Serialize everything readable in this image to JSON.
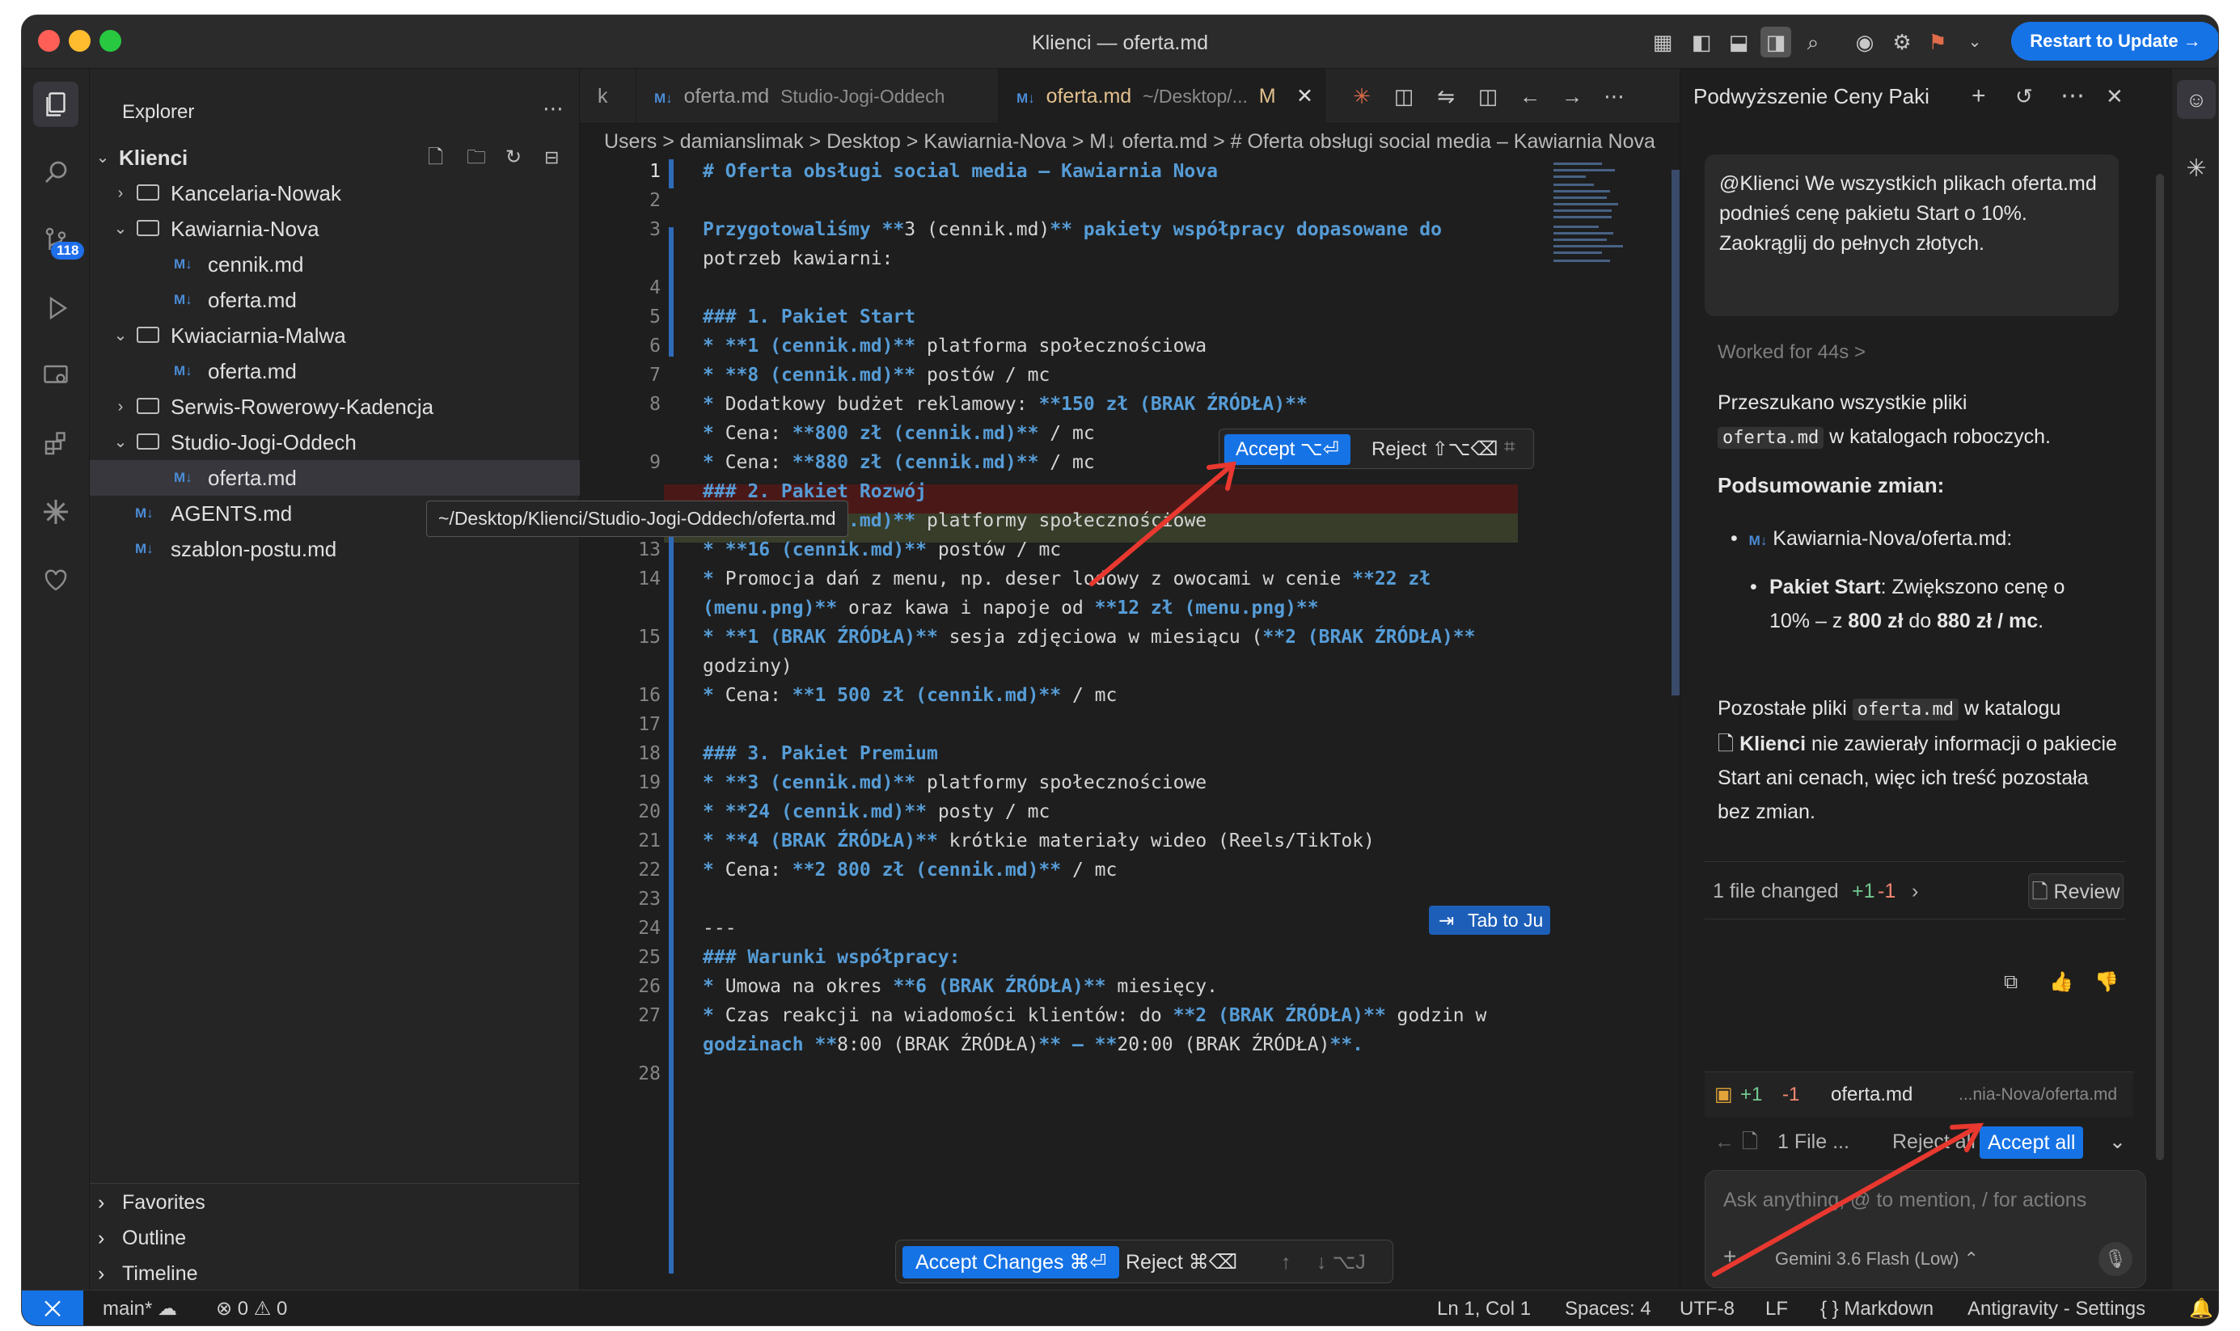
{
  "window": {
    "title": "Klienci — oferta.md",
    "restart_label": "Restart to Update →"
  },
  "activity": {
    "scm_badge": "118"
  },
  "explorer": {
    "title": "Explorer",
    "root": "Klienci",
    "rows": [
      {
        "label": "Kancelaria-Nowak"
      },
      {
        "label": "Kawiarnia-Nova"
      },
      {
        "label": "cennik.md"
      },
      {
        "label": "oferta.md"
      },
      {
        "label": "Kwiaciarnia-Malwa"
      },
      {
        "label": "oferta.md"
      },
      {
        "label": "Serwis-Rowerowy-Kadencja"
      },
      {
        "label": "Studio-Jogi-Oddech"
      },
      {
        "label": "oferta.md"
      },
      {
        "label": "AGENTS.md"
      },
      {
        "label": "szablon-postu.md"
      }
    ],
    "tooltip": "~/Desktop/Klienci/Studio-Jogi-Oddech/oferta.md",
    "sections": [
      "Favorites",
      "Outline",
      "Timeline"
    ]
  },
  "editor": {
    "tabs": [
      {
        "label": "k",
        "dir": ""
      },
      {
        "label": "oferta.md",
        "dir": "Studio-Jogi-Oddech"
      },
      {
        "label": "oferta.md",
        "dir": "~/Desktop/...",
        "mod": "M"
      }
    ],
    "breadcrumb": "Users  >  damianslimak  >  Desktop  >  Kawiarnia-Nova  >  M↓  oferta.md  >  # Oferta obsługi social media – Kawiarnia Nova",
    "line_numbers": [
      "1",
      "2",
      "3",
      "",
      "4",
      "5",
      "6",
      "7",
      "8",
      "",
      "9",
      "",
      "12",
      "13",
      "14",
      "",
      "15",
      "",
      "16",
      "17",
      "18",
      "19",
      "20",
      "21",
      "22",
      "23",
      "24",
      "25",
      "26",
      "27",
      "",
      "28"
    ],
    "lines": [
      "# Oferta obsługi social media – Kawiarnia Nova",
      "",
      "Przygotowaliśmy **3 (cennik.md)** pakiety współpracy dopasowane do",
      "potrzeb kawiarni:",
      "",
      "### 1. Pakiet Start",
      "* **1 (cennik.md)** platforma społecznościowa",
      "* **8 (cennik.md)** postów / mc",
      "* Dodatkowy budżet reklamowy: **150 zł (BRAK ŹRÓDŁA)**",
      "* Cena: **800 zł (cennik.md)** / mc",
      "* Cena: **880 zł (cennik.md)** / mc",
      "### 2. Pakiet Rozwój",
      "* **2 (cennik.md)** platformy społecznościowe",
      "* **16 (cennik.md)** postów / mc",
      "* Promocja dań z menu, np. deser lodowy z owocami w cenie **22 zł",
      "(menu.png)** oraz kawa i napoje od **12 zł (menu.png)**",
      "* **1 (BRAK ŹRÓDŁA)** sesja zdjęciowa w miesiącu (**2 (BRAK ŹRÓDŁA)**",
      "godziny)",
      "* Cena: **1 500 zł (cennik.md)** / mc",
      "",
      "### 3. Pakiet Premium",
      "* **3 (cennik.md)** platformy społecznościowe",
      "* **24 (cennik.md)** posty / mc",
      "* **4 (BRAK ŹRÓDŁA)** krótkie materiały wideo (Reels/TikTok)",
      "* Cena: **2 800 zł (cennik.md)** / mc",
      "",
      "---",
      "### Warunki współpracy:",
      "* Umowa na okres **6 (BRAK ŹRÓDŁA)** miesięcy.",
      "* Czas reakcji na wiadomości klientów: do **2 (BRAK ŹRÓDŁA)** godzin w",
      "godzinach **8:00 (BRAK ŹRÓDŁA)** – **20:00 (BRAK ŹRÓDŁA)**.",
      ""
    ],
    "inline_accept": "Accept ⌥⏎",
    "inline_reject": "Reject ⇧⌥⌫",
    "tab_to_jump": "Tab to Ju",
    "accept_changes": "Accept Changes ⌘⏎",
    "reject_changes": "Reject ⌘⌫"
  },
  "chat": {
    "title": "Podwyższenie Ceny Paki",
    "prompt": "@Klienci We wszystkich plikach oferta.md podnieś cenę pakietu Start o 10%. Zaokrąglij do pełnych złotych.",
    "worked": "Worked for 44s  >",
    "p1a": "Przeszukano wszystkie pliki",
    "p1_code": "oferta.md",
    "p1b": "w katalogach roboczych.",
    "summary_heading": "Podsumowanie zmian:",
    "file_bullet": "Kawiarnia-Nova/oferta.md",
    "sub_bullet_bold": "Pakiet Start",
    "sub_bullet_text": ": Zwiększono cenę o 10% – z ",
    "from_price": "800 zł",
    "mid_text": " do ",
    "to_price": "880 zł / mc",
    "p2a": "Pozostałe pliki",
    "p2_code": "oferta.md",
    "p2b": "w katalogu",
    "p2_folder": "Klienci",
    "p2c": "nie zawierały informacji o pakiecie Start ani cenach, więc ich treść pozostała bez zmian.",
    "files_changed": "1 file changed",
    "plus": "+1",
    "minus": "-1",
    "review": "Review",
    "file_row_name": "oferta.md",
    "file_row_path": "...nia-Nova/oferta.md",
    "one_file": "1 File ...",
    "reject_all": "Reject all",
    "accept_all": "Accept all",
    "input_placeholder": "Ask anything, @ to mention, / for actions",
    "model": "Gemini 3.6 Flash (Low)"
  },
  "status": {
    "branch": "main*",
    "problems": "⊗ 0 ⚠ 0",
    "position": "Ln 1, Col 1",
    "spaces": "Spaces: 4",
    "encoding": "UTF-8",
    "eol": "LF",
    "language": "{ }  Markdown",
    "settings": "Antigravity - Settings"
  },
  "colors": {
    "accent": "#1673e6",
    "deleted": "#4b1818",
    "added": "#373d29"
  }
}
